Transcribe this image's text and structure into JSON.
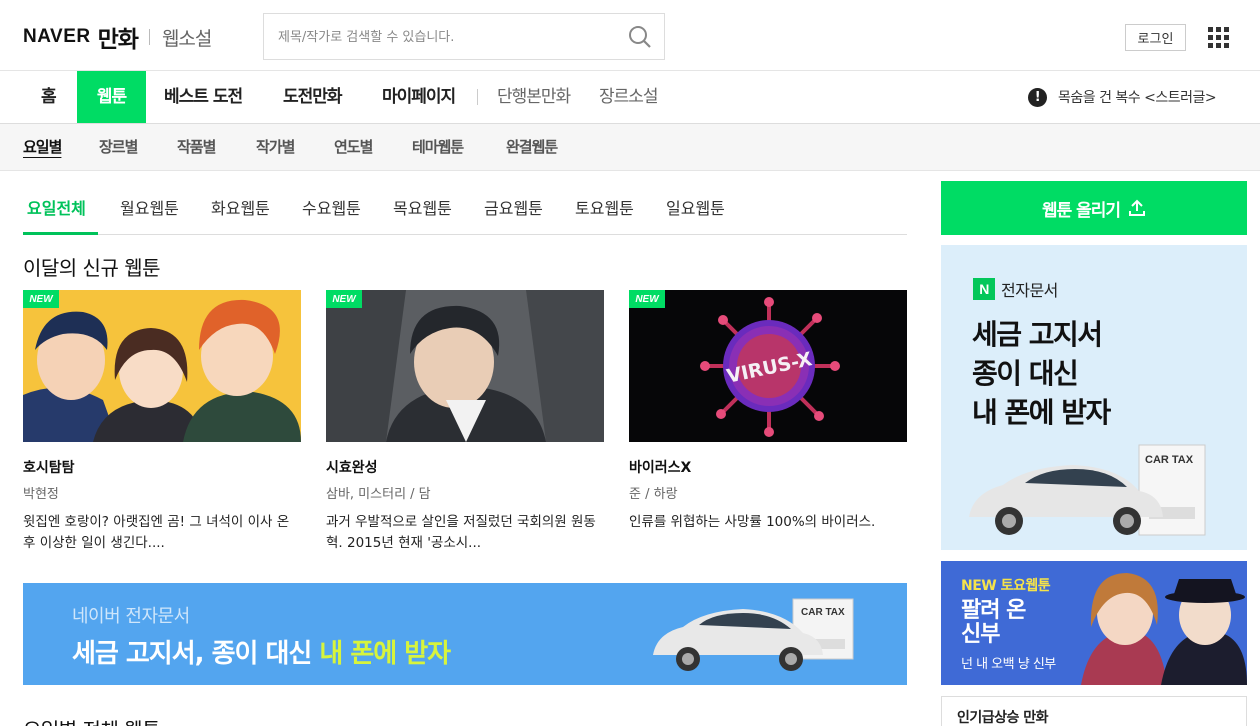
{
  "header": {
    "logo_naver": "NAVER",
    "logo_manhwa": "만화",
    "logo_webnovel": "웹소설",
    "search_placeholder": "제목/작가로 검색할 수 있습니다.",
    "login_label": "로그인"
  },
  "mainnav": {
    "items": [
      "홈",
      "웹툰",
      "베스트 도전",
      "도전만화",
      "마이페이지",
      "단행본만화",
      "장르소설"
    ],
    "active": "웹툰",
    "notice_icon": "!",
    "notice_text": "목숨을 건 복수 <스트러글>"
  },
  "subnav": {
    "items": [
      "요일별",
      "장르별",
      "작품별",
      "작가별",
      "연도별",
      "테마웹툰",
      "완결웹툰"
    ],
    "active": "요일별"
  },
  "daytabs": {
    "items": [
      "요일전체",
      "월요웹툰",
      "화요웹툰",
      "수요웹툰",
      "목요웹툰",
      "금요웹툰",
      "토요웹툰",
      "일요웹툰"
    ],
    "active": "요일전체"
  },
  "new_section": {
    "title": "이달의 신규 웹툰",
    "badge": "NEW",
    "cards": [
      {
        "title": "호시탐탐",
        "author": "박현정",
        "desc": "윗집엔 호랑이? 아랫집엔 곰! 그 녀석이 이사 온 후 이상한 일이 생긴다...."
      },
      {
        "title": "시효완성",
        "author": "삼바, 미스터리 / 담",
        "desc": "과거 우발적으로 살인을 저질렀던 국회의원 원동혁. 2015년 현재 '공소시..."
      },
      {
        "title": "바이러스X",
        "author": "준 / 하랑",
        "desc": "인류를 위협하는 사망률 100%의 바이러스.",
        "thumb_text": "VIRUS-X"
      }
    ]
  },
  "banner": {
    "sub": "네이버 전자문서",
    "main_prefix": "세금 고지서, 종이 대신 ",
    "main_highlight": "내 폰에 받자",
    "car_tax": "CAR TAX"
  },
  "section2_title": "요일별 전체 웹툰",
  "sidebar": {
    "upload_label": "웹툰 올리기",
    "ad1": {
      "logo_letter": "N",
      "logo_text": "전자문서",
      "lines": [
        "세금 고지서",
        "종이 대신",
        "내 폰에 받자"
      ],
      "car_tax": "CAR TAX"
    },
    "ad2": {
      "tag": "NEW 토요웹툰",
      "title_lines": [
        "팔려 온",
        "신부"
      ],
      "sub": "넌 내 오백 냥 신부"
    },
    "popular_title": "인기급상승 만화"
  },
  "colors": {
    "brand_green": "#00dc64",
    "active_tab_green": "#00c25a",
    "banner_blue": "#53a5ef"
  }
}
